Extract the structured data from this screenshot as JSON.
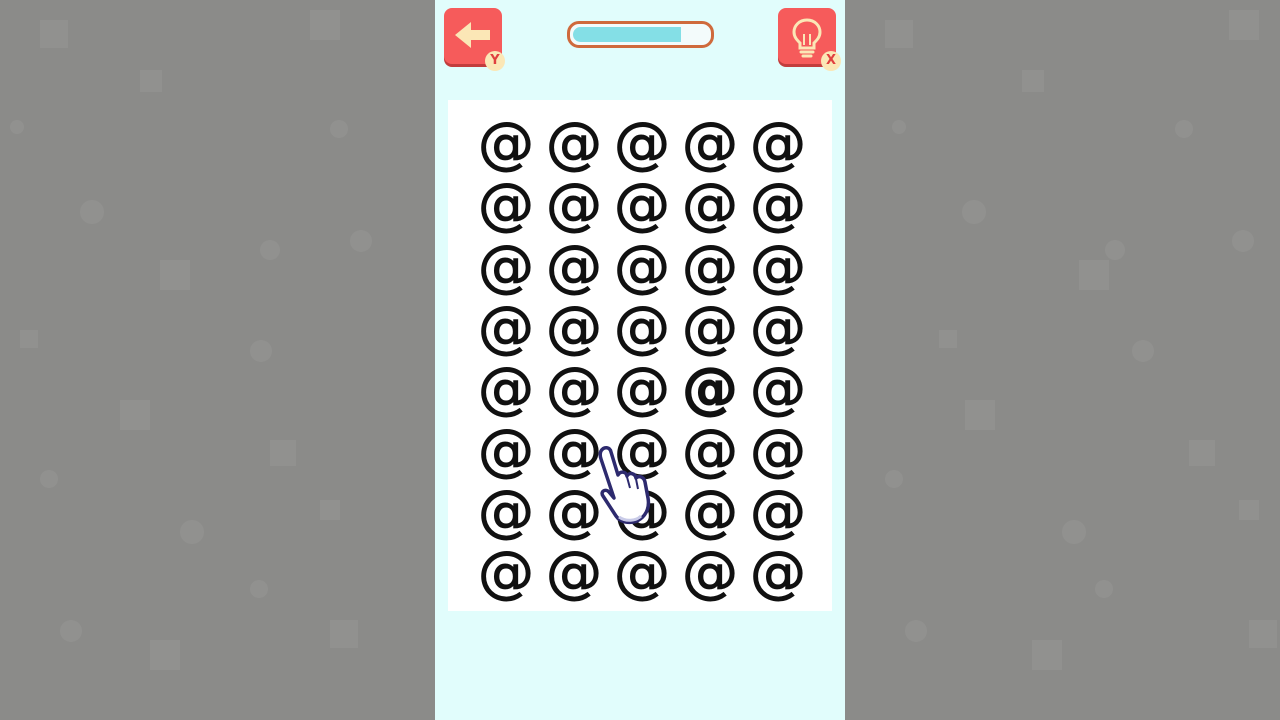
{
  "colors": {
    "background_side": "#8b8b89",
    "phone_background": "#e1fdfc",
    "button_red": "#f65b5b",
    "badge_fill": "#fbe7b6",
    "progress_border": "#cf6a3c",
    "progress_fill": "#84dfe6",
    "board": "#ffffff",
    "glyph": "#111111"
  },
  "header": {
    "back_button": {
      "icon": "arrow-left-icon",
      "badge": "Y"
    },
    "hint_button": {
      "icon": "lightbulb-icon",
      "badge": "X"
    },
    "progress": {
      "fraction": 0.8
    }
  },
  "board": {
    "rows": 8,
    "cols": 5,
    "symbol": "@",
    "odd_cell": {
      "row": 4,
      "col": 3
    }
  },
  "pointer": {
    "icon": "pointing-hand-icon"
  }
}
